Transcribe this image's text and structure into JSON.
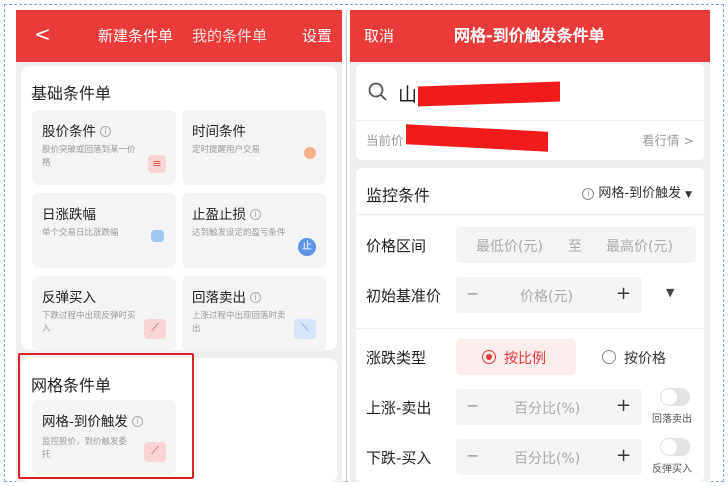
{
  "left": {
    "header": {
      "back": "<",
      "tab_new": "新建条件单",
      "tab_mine": "我的条件单",
      "settings": "设置"
    },
    "basic_title": "基础条件单",
    "basic_items": [
      {
        "title": "股价条件",
        "desc": "股价突破或回落到某一价格",
        "icon": "price-chart-icon",
        "info": "i"
      },
      {
        "title": "时间条件",
        "desc": "定时提醒用户交易",
        "icon": "clock-icon"
      },
      {
        "title": "日涨跌幅",
        "desc": "单个交易日比涨跌幅",
        "icon": "percent-icon"
      },
      {
        "title": "止盈止损",
        "desc": "达到触发设定的盈亏条件",
        "icon": "stop-icon",
        "badge": "止",
        "info": "i"
      },
      {
        "title": "反弹买入",
        "desc": "下跌过程中出现反弹时买入",
        "icon": "rebound-icon"
      },
      {
        "title": "回落卖出",
        "desc": "上涨过程中出现回落时卖出",
        "icon": "fallback-icon",
        "info": "i"
      }
    ],
    "grid_title": "网格条件单",
    "grid_item": {
      "title": "网格-到价触发",
      "desc": "监控股价，到价触发委托",
      "icon": "grid-chart-icon",
      "info": "i"
    }
  },
  "right": {
    "header": {
      "cancel": "取消",
      "title": "网格-到价触发条件单"
    },
    "stock": {
      "search_prefix": "山",
      "price_label": "当前价",
      "quote_link": "看行情 >"
    },
    "monitor": {
      "title": "监控条件",
      "mode": "网格-到价触发",
      "info": "i",
      "price_range_label": "价格区间",
      "min_placeholder": "最低价(元)",
      "to": "至",
      "max_placeholder": "最高价(元)",
      "base_label": "初始基准价",
      "base_placeholder": "价格(元)",
      "type_label": "涨跌类型",
      "type_options": [
        "按比例",
        "按价格"
      ],
      "up_label": "上涨-卖出",
      "up_placeholder": "百分比(%)",
      "up_toggle": "回落卖出",
      "down_label": "下跌-买入",
      "down_placeholder": "百分比(%)",
      "down_toggle": "反弹买入",
      "minus": "−",
      "plus": "+"
    }
  },
  "colors": {
    "brand": "#eb3a3a",
    "highlight": "#e02020",
    "redact": "#f21b1b"
  }
}
